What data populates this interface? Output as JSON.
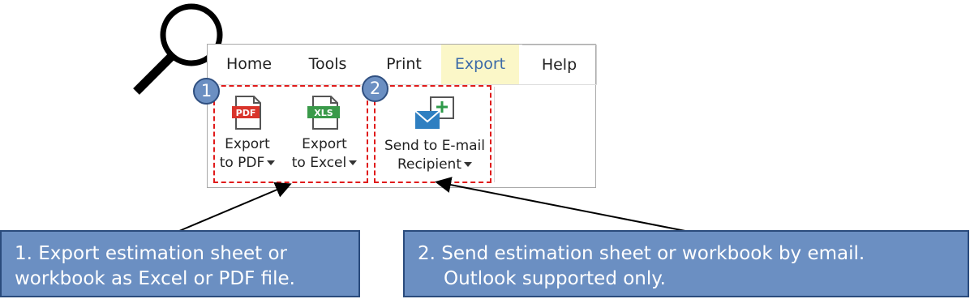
{
  "ribbon": {
    "tabs": [
      {
        "label": "Home",
        "active": false
      },
      {
        "label": "Tools",
        "active": false
      },
      {
        "label": "Print",
        "active": false
      },
      {
        "label": "Export",
        "active": true
      },
      {
        "label": "Help",
        "active": false
      }
    ],
    "commands": {
      "export_pdf": {
        "line1": "Export",
        "line2": "to PDF",
        "icon": "pdf-file-icon",
        "icon_text": "PDF"
      },
      "export_excel": {
        "line1": "Export",
        "line2": "to Excel",
        "icon": "xls-file-icon",
        "icon_text": "XLS"
      },
      "send_email": {
        "line1": "Send to E-mail",
        "line2": "Recipient",
        "icon": "mail-add-icon"
      }
    }
  },
  "badges": {
    "one": "1",
    "two": "2"
  },
  "callouts": {
    "left": {
      "line1": "1. Export estimation sheet or",
      "line2": "workbook as Excel or PDF file."
    },
    "right": {
      "line1": "2. Send estimation sheet or workbook by email.",
      "line2": "Outlook supported only."
    }
  },
  "colors": {
    "accent_blue": "#6b8fc2",
    "active_tab": "#fbf7c8",
    "dash_red": "#e01b1b",
    "pdf_red": "#d9342b",
    "xls_green": "#3a9a4a",
    "mail_blue": "#2f7fc1"
  }
}
